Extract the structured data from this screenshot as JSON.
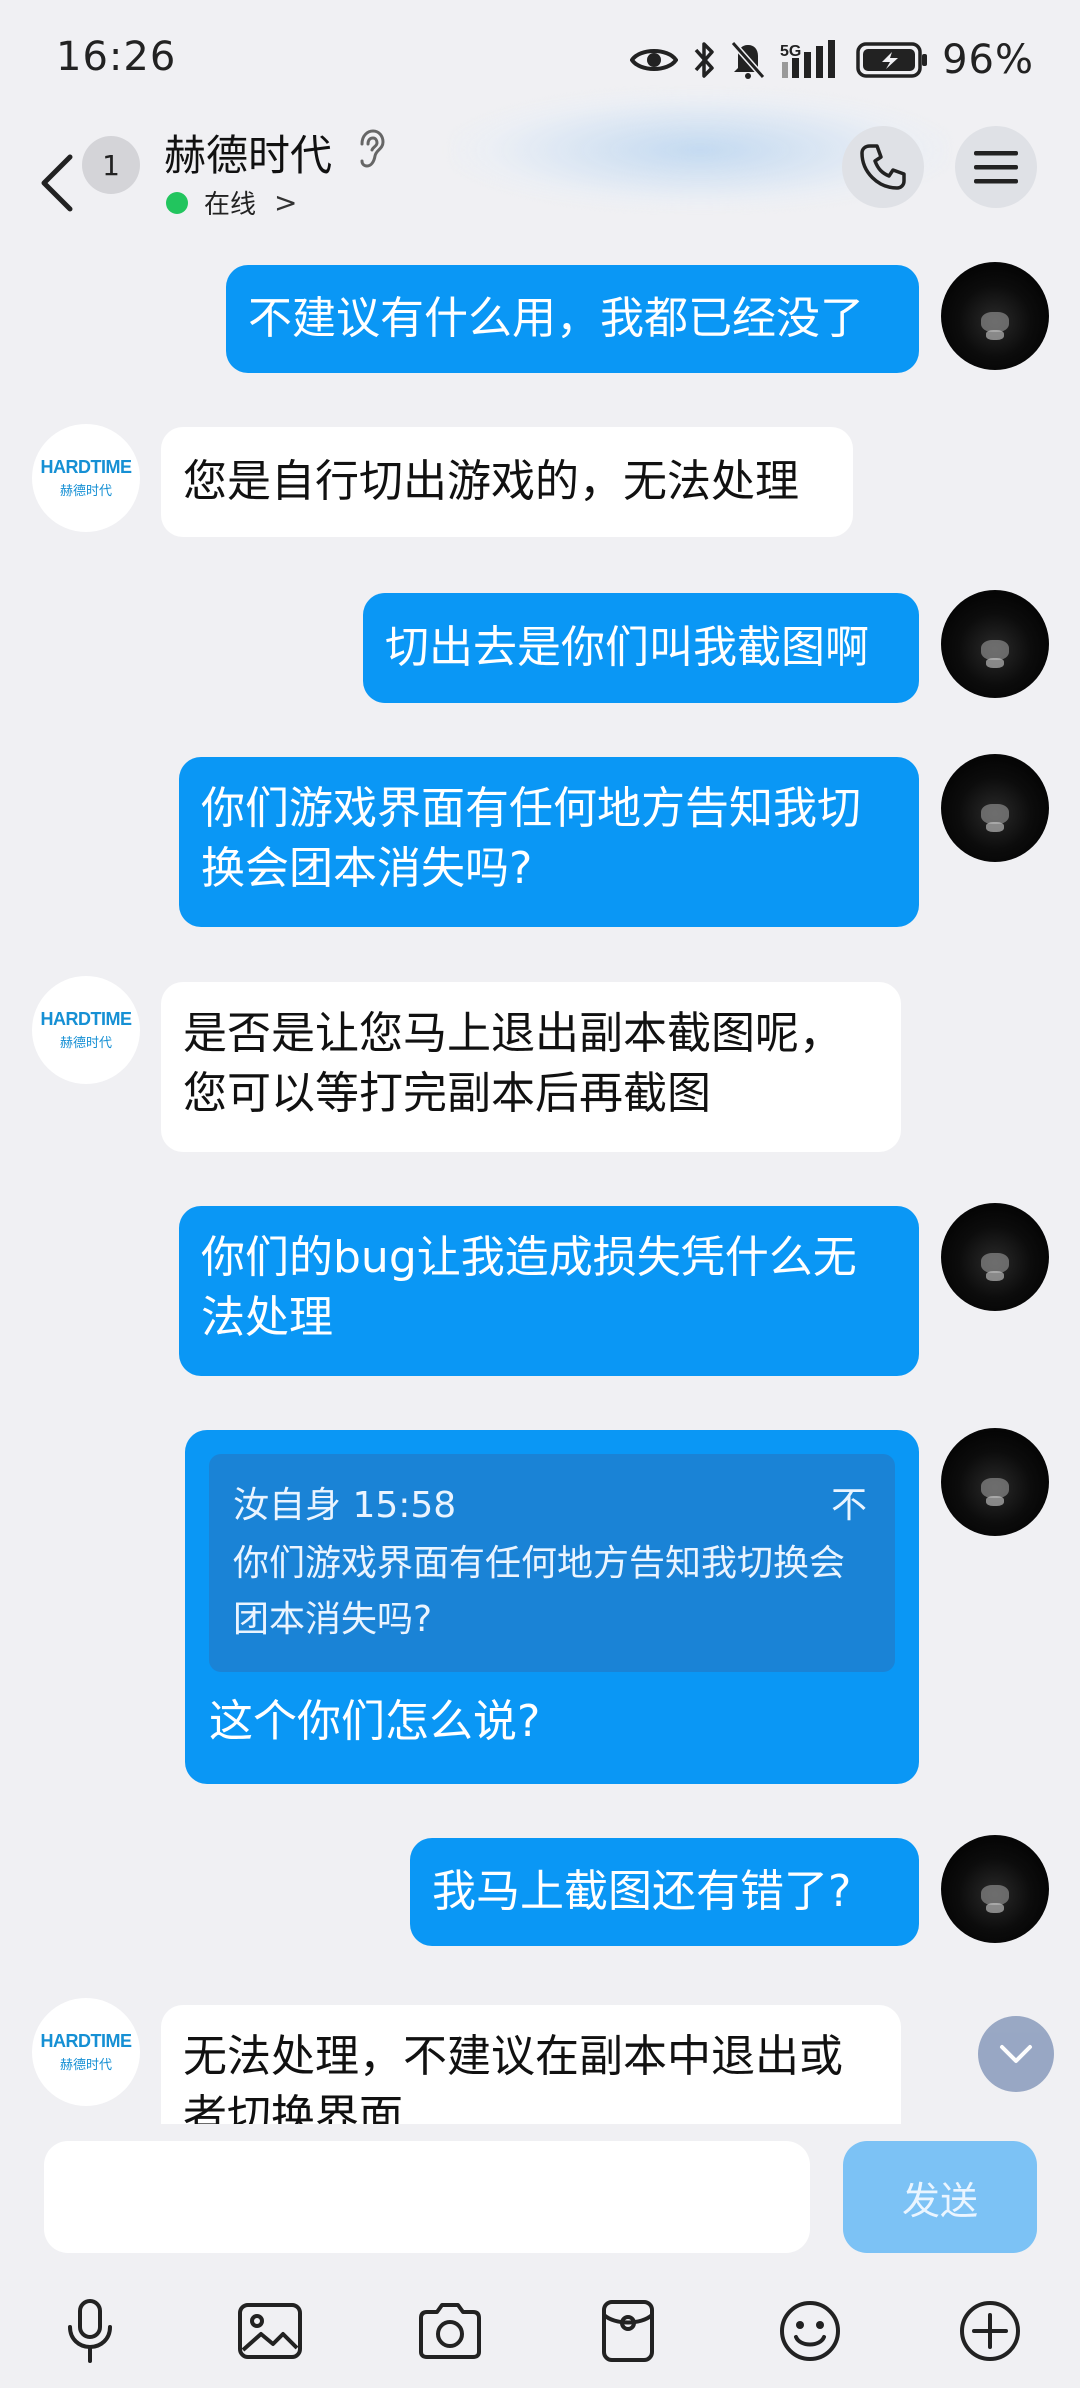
{
  "status_bar": {
    "time": "16:26",
    "battery_percent": "96%",
    "network": "5G"
  },
  "header": {
    "back_label": "<",
    "unread_count": "1",
    "title": "赫德时代",
    "online_status": "在线",
    "online_chevron": ">"
  },
  "messages": [
    {
      "side": "out",
      "text": "不建议有什么用，我都已经没了"
    },
    {
      "side": "in",
      "text": "您是自行切出游戏的，无法处理"
    },
    {
      "side": "out",
      "text": "切出去是你们叫我截图啊"
    },
    {
      "side": "out",
      "text": "你们游戏界面有任何地方告知我切换会团本消失吗?"
    },
    {
      "side": "in",
      "text": "是否是让您马上退出副本截图呢，您可以等打完副本后再截图"
    },
    {
      "side": "out",
      "text": "你们的bug让我造成损失凭什么无法处理"
    },
    {
      "side": "out",
      "quote_meta": "汝自身 15:58",
      "quote_text": "你们游戏界面有任何地方告知我切换会团本消失吗?",
      "text": "这个你们怎么说?"
    },
    {
      "side": "out",
      "text": "我马上截图还有错了?"
    },
    {
      "side": "in",
      "text": "无法处理，不建议在副本中退出或者切换界面"
    }
  ],
  "biz_avatar": {
    "logo": "HARDTIME",
    "sub": "赫德时代"
  },
  "quote_collapse": "不",
  "input": {
    "value": "",
    "placeholder": ""
  },
  "send_label": "发送",
  "toolbar": [
    "mic-icon",
    "image-icon",
    "camera-icon",
    "red-packet-icon",
    "emoji-icon",
    "plus-icon"
  ],
  "colors": {
    "outgoing": "#0a97f5",
    "incoming": "#ffffff",
    "send_disabled": "#7cc2f5",
    "online": "#22c55e"
  }
}
